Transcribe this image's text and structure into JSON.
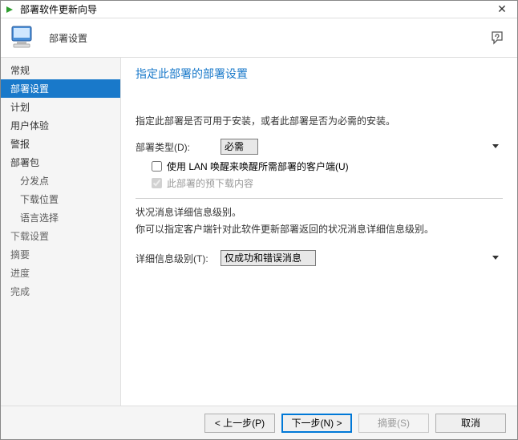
{
  "window": {
    "title": "部署软件更新向导",
    "close_glyph": "✕"
  },
  "header": {
    "subtitle": "部署设置"
  },
  "sidebar": {
    "items": [
      {
        "label": "常规"
      },
      {
        "label": "部署设置"
      },
      {
        "label": "计划"
      },
      {
        "label": "用户体验"
      },
      {
        "label": "警报"
      },
      {
        "label": "部署包"
      },
      {
        "label": "分发点"
      },
      {
        "label": "下载位置"
      },
      {
        "label": "语言选择"
      },
      {
        "label": "下载设置"
      },
      {
        "label": "摘要"
      },
      {
        "label": "进度"
      },
      {
        "label": "完成"
      }
    ]
  },
  "content": {
    "heading": "指定此部署的部署设置",
    "desc1": "指定此部署是否可用于安装，或者此部署是否为必需的安装。",
    "type_label": "部署类型(D):",
    "type_value": "必需",
    "chk1_label": "使用 LAN 唤醒来唤醒所需部署的客户端(U)",
    "chk2_label": "此部署的预下载内容",
    "section2_title": "状况消息详细信息级别。",
    "section2_desc": "你可以指定客户端针对此软件更新部署返回的状况消息详细信息级别。",
    "detail_label": "详细信息级别(T):",
    "detail_value": "仅成功和错误消息"
  },
  "footer": {
    "back": "< 上一步(P)",
    "next": "下一步(N) >",
    "summary": "摘要(S)",
    "cancel": "取消"
  }
}
